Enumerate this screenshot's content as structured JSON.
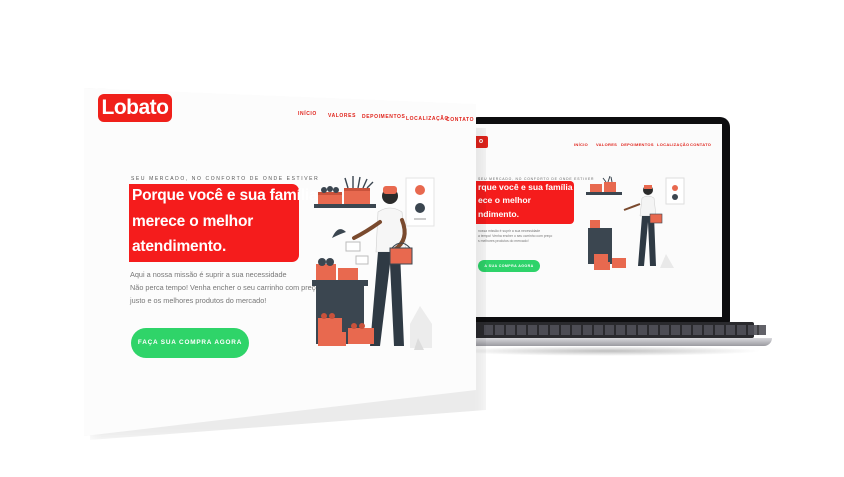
{
  "brand": {
    "logo_text": "Lobato",
    "accent": "#f51c1c",
    "cta_color": "#2fd469"
  },
  "nav": {
    "items": [
      "INÍCIO",
      "VALORES",
      "DEPOIMENTOS",
      "LOCALIZAÇÃO",
      "CONTATO"
    ]
  },
  "hero": {
    "tagline": "SEU MERCADO, NO CONFORTO DE ONDE ESTIVER",
    "headline_lines": [
      "Porque você e sua família",
      "merece o melhor",
      "atendimento."
    ],
    "body_lines": [
      "Aqui a nossa missão é suprir a sua necessidade",
      "Não perca tempo! Venha encher o seu carrinho com preço",
      "justo e os melhores produtos do mercado!"
    ],
    "cta_label": "FAÇA SUA COMPRA AGORA"
  },
  "laptop_screen": {
    "logo_text": "o",
    "nav_items": [
      "INÍCIO",
      "VALORES",
      "DEPOIMENTOS",
      "LOCALIZAÇÃO",
      "CONTATO"
    ],
    "tagline": "SEU MERCADO, NO CONFORTO DE ONDE ESTIVER",
    "headline_lines": [
      "rque você e sua família",
      "ece o melhor",
      "ndimento."
    ],
    "body_lines": [
      "nossa missão é suprir a sua necessidade",
      "a tempo! Venha encher o seu carrinho com preço",
      "s melhores produtos do mercado!"
    ],
    "cta_label": "A SUA COMPRA AGORA"
  },
  "icons": [
    "grocery-seller-illustration",
    "laptop-device"
  ]
}
